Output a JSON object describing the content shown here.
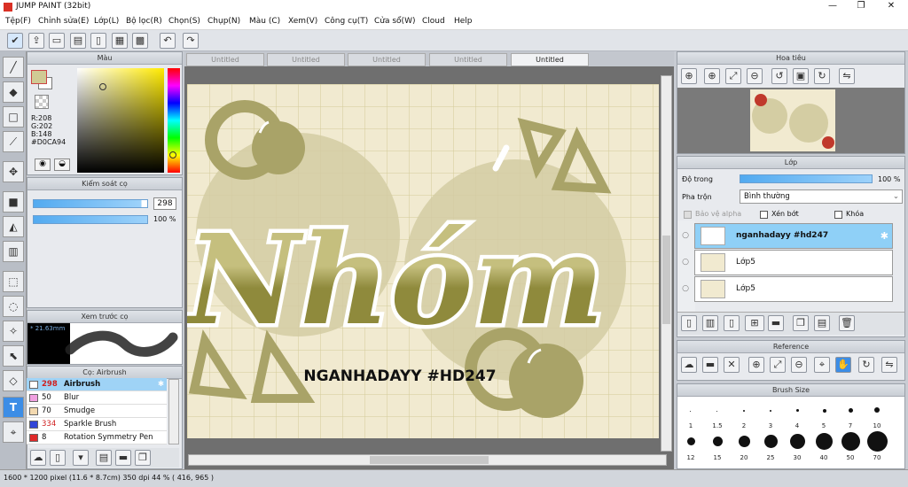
{
  "app": {
    "title": "JUMP PAINT (32bit)"
  },
  "menu": [
    "Tệp(F)",
    "Chỉnh sửa(E)",
    "Lớp(L)",
    "Bộ lọc(R)",
    "Chọn(S)",
    "Chụp(N)",
    "Màu (C)",
    "Xem(V)",
    "Công cụ(T)",
    "Cửa sổ(W)",
    "Cloud",
    "Help"
  ],
  "colors": {
    "accent": "#3c8de6",
    "canvas_bg": "#f1ead0",
    "ink": "#8f8a3c",
    "current_color": "#D0CA94"
  },
  "color_panel": {
    "title": "Màu",
    "r": "R:208",
    "g": "G:202",
    "b": "B:148",
    "hex": "#D0CA94"
  },
  "brush_control": {
    "title": "Kiểm soát cọ",
    "size": "298",
    "opacity": "100 %",
    "size_fill": 0.95,
    "opacity_fill": 1.0
  },
  "brush_preview": {
    "title": "Xem trước cọ",
    "size_label": "* 21.63mm"
  },
  "brush_list": {
    "title": "Cọ: Airbrush",
    "items": [
      {
        "num": "298",
        "name": "Airbrush",
        "color": "#ffffff",
        "selected": true
      },
      {
        "num": "50",
        "name": "Blur",
        "color": "#f0a0e0",
        "selected": false
      },
      {
        "num": "70",
        "name": "Smudge",
        "color": "#f3d9b0",
        "selected": false
      },
      {
        "num": "334",
        "name": "Sparkle Brush",
        "color": "#3146d8",
        "selected": false
      },
      {
        "num": "8",
        "name": "Rotation Symmetry Pen",
        "color": "#e02a2a",
        "selected": false
      }
    ]
  },
  "tabs": [
    "Untitled",
    "Untitled",
    "Untitled",
    "Untitled",
    "Untitled"
  ],
  "artwork": {
    "title": "Nhóm",
    "subtitle": "NGANHADAYY #HD247"
  },
  "navigator": {
    "title": "Hoa tiêu"
  },
  "layer_panel": {
    "title": "Lớp",
    "opacity_label": "Độ trong",
    "opacity_value": "100 %",
    "opacity_fill": 1.0,
    "blend_label": "Pha trộn",
    "blend_value": "Bình thường",
    "protect_alpha": "Bảo vệ alpha",
    "clipping": "Xén bớt",
    "lock": "Khóa",
    "layers": [
      {
        "name": "nganhadayy #hd247",
        "selected": true
      },
      {
        "name": "Lớp5",
        "selected": false
      },
      {
        "name": "Lớp5",
        "selected": false
      }
    ]
  },
  "reference_panel": {
    "title": "Reference"
  },
  "brush_size_panel": {
    "title": "Brush Size",
    "row1": [
      "1",
      "1.5",
      "2",
      "3",
      "4",
      "5",
      "7",
      "10"
    ],
    "row2": [
      "12",
      "15",
      "20",
      "25",
      "30",
      "40",
      "50",
      "70"
    ]
  },
  "status": {
    "text": "1600 * 1200 pixel   (11.6 * 8.7cm)   350 dpi   44 %   ( 416, 965 )"
  }
}
